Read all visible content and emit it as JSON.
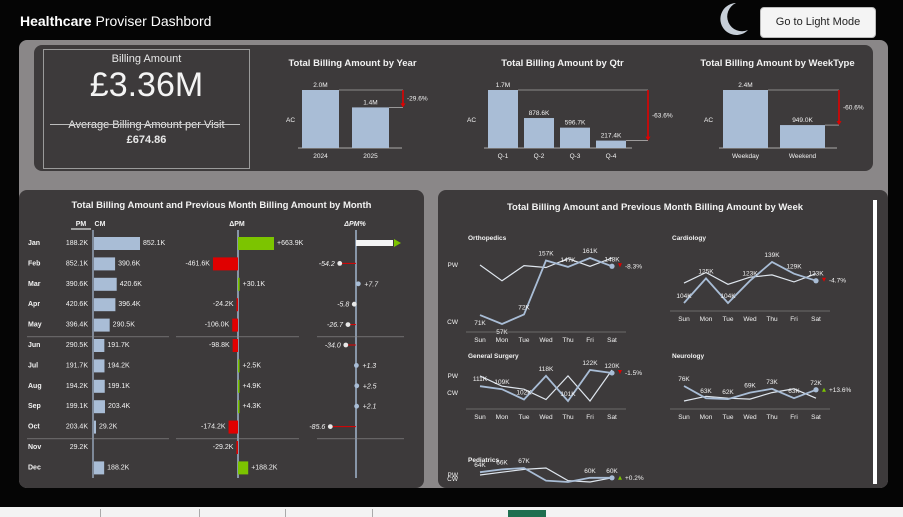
{
  "header": {
    "title_bold": "Healthcare",
    "title_rest": " Proviser Dashbord",
    "mode_button": "Go to Light Mode"
  },
  "kpi": {
    "billing_label": "Billing Amount",
    "billing_value": "£3.36M",
    "avg_label": "Average Billing Amount per Visit",
    "avg_value": "£674.86"
  },
  "year_chart": {
    "title": "Total Billing Amount by Year",
    "axis": "AC",
    "categories": [
      "2024",
      "2025"
    ],
    "labels": [
      "2.0M",
      "1.4M"
    ],
    "variance": "-29.6%"
  },
  "qtr_chart": {
    "title": "Total Billing Amount by Qtr",
    "axis": "AC",
    "categories": [
      "Q-1",
      "Q-2",
      "Q-3",
      "Q-4"
    ],
    "labels": [
      "1.7M",
      "878.6K",
      "596.7K",
      "217.4K"
    ],
    "variance": "-63.6%"
  },
  "week_chart": {
    "title": "Total Billing Amount by WeekType",
    "axis": "AC",
    "categories": [
      "Weekday",
      "Weekend"
    ],
    "labels": [
      "2.4M",
      "949.0K"
    ],
    "variance": "-60.6%"
  },
  "month_table": {
    "title": "Total Billing Amount and Previous Month Billing Amount by Month",
    "col_pm": "PM",
    "col_cm": "CM",
    "col_dpm": "ΔPM",
    "col_dpmp": "ΔPM%",
    "rows": [
      {
        "m": "Jan",
        "pm": "188.2K",
        "cm": "852.1K",
        "dpm": "+663.9K",
        "dpmp": ""
      },
      {
        "m": "Feb",
        "pm": "852.1K",
        "cm": "390.6K",
        "dpm": "-461.6K",
        "dpmp": "-54.2"
      },
      {
        "m": "Mar",
        "pm": "390.6K",
        "cm": "420.6K",
        "dpm": "+30.1K",
        "dpmp": "+7.7"
      },
      {
        "m": "Apr",
        "pm": "420.6K",
        "cm": "396.4K",
        "dpm": "-24.2K",
        "dpmp": "-5.8"
      },
      {
        "m": "May",
        "pm": "396.4K",
        "cm": "290.5K",
        "dpm": "-106.0K",
        "dpmp": "-26.7"
      },
      {
        "m": "Jun",
        "pm": "290.5K",
        "cm": "191.7K",
        "dpm": "-98.8K",
        "dpmp": "-34.0"
      },
      {
        "m": "Jul",
        "pm": "191.7K",
        "cm": "194.2K",
        "dpm": "+2.5K",
        "dpmp": "+1.3"
      },
      {
        "m": "Aug",
        "pm": "194.2K",
        "cm": "199.1K",
        "dpm": "+4.9K",
        "dpmp": "+2.5"
      },
      {
        "m": "Sep",
        "pm": "199.1K",
        "cm": "203.4K",
        "dpm": "+4.3K",
        "dpmp": "+2.1"
      },
      {
        "m": "Oct",
        "pm": "203.4K",
        "cm": "29.2K",
        "dpm": "-174.2K",
        "dpmp": "-85.6"
      },
      {
        "m": "Nov",
        "pm": "29.2K",
        "cm": "",
        "dpm": "-29.2K",
        "dpmp": ""
      },
      {
        "m": "Dec",
        "pm": "",
        "cm": "188.2K",
        "dpm": "+188.2K",
        "dpmp": ""
      }
    ]
  },
  "week_panel": {
    "title": "Total Billing Amount and Previous Month Billing Amount by Week",
    "days": [
      "Sun",
      "Mon",
      "Tue",
      "Wed",
      "Thu",
      "Fri",
      "Sat"
    ],
    "legend_pw": "PW",
    "legend_cw": "CW",
    "charts": [
      {
        "name": "Orthopedics",
        "labels": [
          "71K",
          "57K",
          "72K",
          "157K",
          "147K",
          "161K",
          "148K"
        ],
        "variance": "-8.3%"
      },
      {
        "name": "Cardiology",
        "labels": [
          "104K",
          "125K",
          "104K",
          "123K",
          "139K",
          "129K",
          "123K"
        ],
        "variance": "-4.7%"
      },
      {
        "name": "General Surgery",
        "labels": [
          "111K",
          "109K",
          "102K",
          "118K",
          "101K",
          "122K",
          "120K"
        ],
        "variance": "-1.5%"
      },
      {
        "name": "Neurology",
        "labels": [
          "76K",
          "63K",
          "62K",
          "69K",
          "73K",
          "63K",
          "72K"
        ],
        "variance": "+13.6%"
      },
      {
        "name": "Pediatrics",
        "labels": [
          "64K",
          "66K",
          "67K",
          "60K",
          "60K"
        ],
        "variance": "+0.2%"
      }
    ]
  },
  "chart_data": [
    {
      "type": "bar",
      "title": "Total Billing Amount by Year",
      "categories": [
        "2024",
        "2025"
      ],
      "values": [
        2000000,
        1400000
      ]
    },
    {
      "type": "bar",
      "title": "Total Billing Amount by Qtr",
      "categories": [
        "Q-1",
        "Q-2",
        "Q-3",
        "Q-4"
      ],
      "values": [
        1700000,
        878600,
        596700,
        217400
      ]
    },
    {
      "type": "bar",
      "title": "Total Billing Amount by WeekType",
      "categories": [
        "Weekday",
        "Weekend"
      ],
      "values": [
        2400000,
        949000
      ]
    },
    {
      "type": "bar",
      "title": "Total Billing Amount and Previous Month Billing Amount by Month",
      "categories": [
        "Jan",
        "Feb",
        "Mar",
        "Apr",
        "May",
        "Jun",
        "Jul",
        "Aug",
        "Sep",
        "Oct",
        "Nov",
        "Dec"
      ],
      "series": [
        {
          "name": "PM",
          "values": [
            188200,
            852100,
            390600,
            420600,
            396400,
            290500,
            191700,
            194200,
            199100,
            203400,
            29200,
            null
          ]
        },
        {
          "name": "CM",
          "values": [
            852100,
            390600,
            420600,
            396400,
            290500,
            191700,
            194200,
            199100,
            203400,
            29200,
            null,
            188200
          ]
        },
        {
          "name": "ΔPM",
          "values": [
            663900,
            -461600,
            30100,
            -24200,
            -106000,
            -98800,
            2500,
            4900,
            4300,
            -174200,
            -29200,
            188200
          ]
        },
        {
          "name": "ΔPM%",
          "values": [
            null,
            -54.2,
            7.7,
            -5.8,
            -26.7,
            -34.0,
            1.3,
            2.5,
            2.1,
            -85.6,
            null,
            null
          ]
        }
      ]
    },
    {
      "type": "line",
      "title": "Orthopedics",
      "categories": [
        "Sun",
        "Mon",
        "Tue",
        "Wed",
        "Thu",
        "Fri",
        "Sat"
      ],
      "series": [
        {
          "name": "CW",
          "values": [
            71,
            57,
            72,
            157,
            147,
            161,
            148
          ]
        },
        {
          "name": "PW",
          "values": [
            150,
            125,
            149,
            146,
            160,
            148,
            161
          ]
        }
      ]
    },
    {
      "type": "line",
      "title": "Cardiology",
      "categories": [
        "Sun",
        "Mon",
        "Tue",
        "Wed",
        "Thu",
        "Fri",
        "Sat"
      ],
      "series": [
        {
          "name": "CW",
          "values": [
            104,
            125,
            104,
            123,
            139,
            129,
            123
          ]
        },
        {
          "name": "PW",
          "values": [
            121,
            130,
            120,
            126,
            128,
            122,
            129
          ]
        }
      ]
    },
    {
      "type": "line",
      "title": "General Surgery",
      "categories": [
        "Sun",
        "Mon",
        "Tue",
        "Wed",
        "Thu",
        "Fri",
        "Sat"
      ],
      "series": [
        {
          "name": "CW",
          "values": [
            111,
            109,
            102,
            118,
            101,
            122,
            120
          ]
        },
        {
          "name": "PW",
          "values": [
            118,
            111,
            109,
            102,
            118,
            101,
            122
          ]
        }
      ]
    },
    {
      "type": "line",
      "title": "Neurology",
      "categories": [
        "Sun",
        "Mon",
        "Tue",
        "Wed",
        "Thu",
        "Fri",
        "Sat"
      ],
      "series": [
        {
          "name": "CW",
          "values": [
            76,
            63,
            62,
            69,
            73,
            63,
            72
          ]
        },
        {
          "name": "PW",
          "values": [
            60,
            65,
            63,
            62,
            69,
            73,
            63
          ]
        }
      ]
    },
    {
      "type": "line",
      "title": "Pediatrics",
      "categories": [
        "Sun",
        "Mon",
        "Tue",
        "Wed",
        "Thu",
        "Fri",
        "Sat"
      ],
      "series": [
        {
          "name": "CW",
          "values": [
            64,
            66,
            67,
            58,
            57,
            60,
            60
          ]
        },
        {
          "name": "PW",
          "values": [
            62,
            64,
            66,
            67,
            58,
            57,
            60
          ]
        }
      ]
    }
  ],
  "colors": {
    "bar": "#a9bdd6",
    "positive": "#7cc400",
    "negative": "#e00000",
    "panel": "#3d3a3b",
    "frame": "#8a8788"
  }
}
